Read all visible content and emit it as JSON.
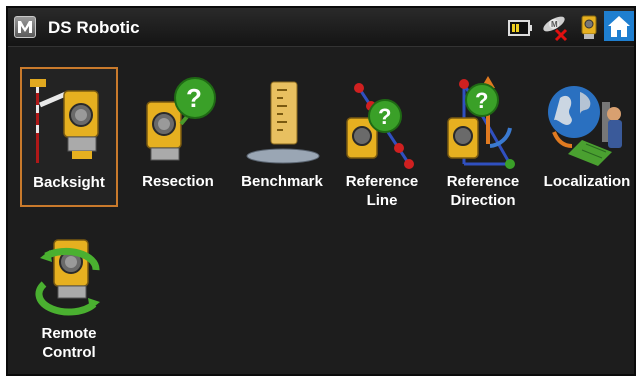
{
  "window": {
    "title": "DS Robotic",
    "app_icon_letter": "M"
  },
  "status_icons": [
    "battery-icon",
    "gnss-disconnected-icon",
    "total-station-icon",
    "home-icon"
  ],
  "tiles": [
    {
      "label": "Backsight",
      "icon": "backsight-icon",
      "selected": true
    },
    {
      "label": "Resection",
      "icon": "resection-icon"
    },
    {
      "label": "Benchmark",
      "icon": "benchmark-icon"
    },
    {
      "label": "Reference\nLine",
      "icon": "reference-line-icon"
    },
    {
      "label": "Reference\nDirection",
      "icon": "reference-direction-icon"
    },
    {
      "label": "Localization",
      "icon": "localization-icon"
    },
    {
      "label": "Remote\nControl",
      "icon": "remote-control-icon"
    }
  ],
  "colors": {
    "selection_border": "#c97a2c",
    "home_blue": "#1f7fd0",
    "background": "#1d1d1d"
  }
}
